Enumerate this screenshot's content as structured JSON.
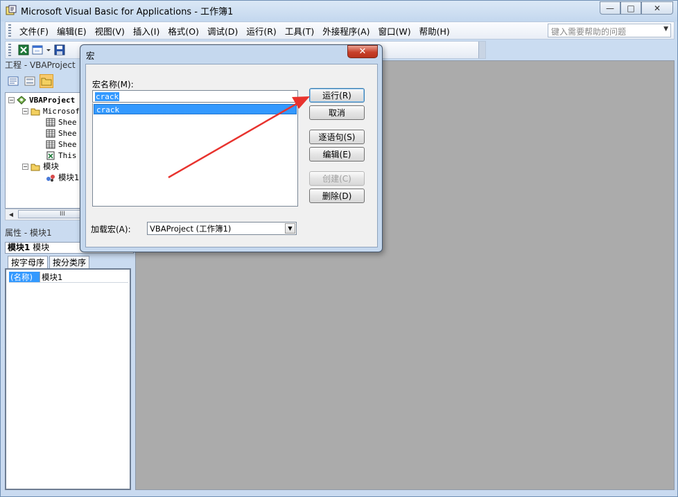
{
  "app": {
    "title": "Microsoft Visual Basic for Applications - 工作簿1",
    "window_buttons": {
      "minimize": "—",
      "restore": "□",
      "close": "✕"
    }
  },
  "menu": {
    "items": [
      "文件(F)",
      "编辑(E)",
      "视图(V)",
      "插入(I)",
      "格式(O)",
      "调试(D)",
      "运行(R)",
      "工具(T)",
      "外接程序(A)",
      "窗口(W)",
      "帮助(H)"
    ],
    "help_placeholder": "键入需要帮助的问题",
    "help_dropdown": "▼"
  },
  "project_panel": {
    "title": "工程 - VBAProject",
    "tree": {
      "root": "VBAProject",
      "objects_folder": "Microsoft",
      "sheets": [
        "Shee",
        "Shee",
        "Shee"
      ],
      "this_workbook": "This",
      "modules_folder": "模块",
      "module": "模块1"
    },
    "scroll_thumb": "III"
  },
  "properties_panel": {
    "title": "属性 - 模块1",
    "object_name": "模块1",
    "object_type": "模块",
    "tabs": [
      "按字母序",
      "按分类序"
    ],
    "row": {
      "key": "(名称)",
      "value": "模块1"
    }
  },
  "dialog": {
    "title": "宏",
    "close": "✕",
    "macro_name_label": "宏名称(M):",
    "macro_name_value": "crack",
    "macro_list": [
      "crack"
    ],
    "buttons": {
      "run": "运行(R)",
      "cancel": "取消",
      "step": "逐语句(S)",
      "edit": "编辑(E)",
      "create": "创建(C)",
      "delete": "删除(D)"
    },
    "macros_in_label": "加载宏(A):",
    "macros_in_value": "VBAProject (工作簿1)",
    "combo_dropdown": "▼"
  },
  "colors": {
    "selection": "#3399ff",
    "workspace": "#ababab",
    "annotation_arrow": "#e8332e"
  }
}
